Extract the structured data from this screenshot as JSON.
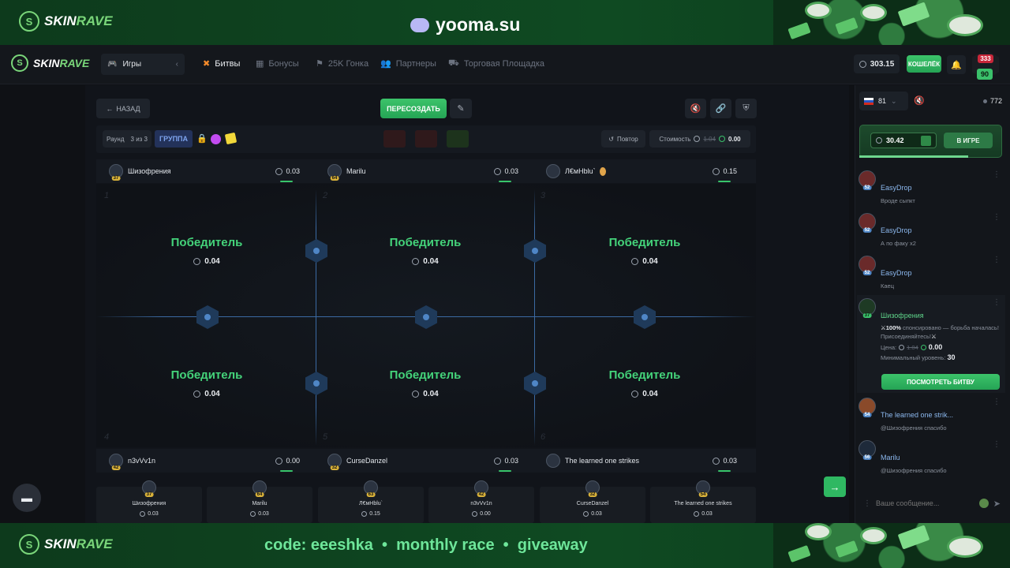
{
  "banner": {
    "brand_skin": "SKIN",
    "brand_rave": "RAVE",
    "site": "yooma.su",
    "promo": "code: eeeshka  •  monthly race  •  giveaway"
  },
  "nav": {
    "games_label": "Игры",
    "items": [
      {
        "label": "Битвы",
        "icon": "crossed-swords-icon",
        "active": true
      },
      {
        "label": "Бонусы",
        "icon": "gift-icon",
        "active": false
      },
      {
        "label": "25K Гонка",
        "icon": "flag-icon",
        "active": false
      },
      {
        "label": "Партнеры",
        "icon": "users-icon",
        "active": false
      },
      {
        "label": "Торговая Площадка",
        "icon": "car-icon",
        "active": false
      }
    ],
    "balance": "303.15",
    "wallet_label": "КОШЕЛЁК",
    "user_level": "90",
    "avatar_badge": "333"
  },
  "battle": {
    "back_label": "НАЗАД",
    "recreate_label": "ПЕРЕСОЗДАТЬ",
    "round_label": "Раунд",
    "round_value": "3 из 3",
    "group_label": "ГРУППА",
    "replay_label": "Повтор",
    "cost_label": "Стоимость",
    "cost_old": "1.04",
    "cost_new": "0.00",
    "top_players": [
      {
        "name": "Шизофрения",
        "level": "37",
        "value": "0.03"
      },
      {
        "name": "Marilu",
        "level": "64",
        "value": "0.03"
      },
      {
        "name": "Л€мНblu`",
        "level": "",
        "value": "0.15"
      }
    ],
    "bottom_players": [
      {
        "name": "n3vVv1n",
        "level": "42",
        "value": "0.00"
      },
      {
        "name": "CurseDanzel",
        "level": "32",
        "value": "0.03"
      },
      {
        "name": "The learned one strikes",
        "level": "",
        "value": "0.03"
      }
    ],
    "cells": [
      {
        "num": "1",
        "winner": "Победитель",
        "amount": "0.04"
      },
      {
        "num": "2",
        "winner": "Победитель",
        "amount": "0.04"
      },
      {
        "num": "3",
        "winner": "Победитель",
        "amount": "0.04"
      },
      {
        "num": "4",
        "winner": "Победитель",
        "amount": "0.04"
      },
      {
        "num": "5",
        "winner": "Победитель",
        "amount": "0.04"
      },
      {
        "num": "6",
        "winner": "Победитель",
        "amount": "0.04"
      }
    ],
    "summary": [
      {
        "name": "Шизофрения",
        "level": "37",
        "value": "0.03"
      },
      {
        "name": "Marilu",
        "level": "64",
        "value": "0.03"
      },
      {
        "name": "Л€мНblu`",
        "level": "63",
        "value": "0.15"
      },
      {
        "name": "n3vVv1n",
        "level": "42",
        "value": "0.00"
      },
      {
        "name": "CurseDanzel",
        "level": "32",
        "value": "0.03"
      },
      {
        "name": "The learned one strikes",
        "level": "54",
        "value": "0.03"
      }
    ]
  },
  "chat": {
    "lang_count": "81",
    "online": "772",
    "rain_amount": "30.42",
    "in_game_label": "В ИГРЕ",
    "messages": [
      {
        "name": "EasyDrop",
        "level": "52",
        "text": "Вроде сыпкт"
      },
      {
        "name": "EasyDrop",
        "level": "52",
        "text": "А по факу x2"
      },
      {
        "name": "EasyDrop",
        "level": "52",
        "text": "Каец"
      }
    ],
    "battle_msg": {
      "name": "Шизофрения",
      "level": "37",
      "percent": "100%",
      "line1": "спонсировано — борьба началась!",
      "line2": "Присоединяйтесь!",
      "price_label": "Цена:",
      "price_old": "1.04",
      "price_new": "0.00",
      "min_level_label": "Минимальный уровень:",
      "min_level": "30",
      "button": "ПОСМОТРЕТЬ БИТВУ"
    },
    "messages2": [
      {
        "name": "The learned one strik...",
        "level": "54",
        "text": "@Шизофрения спасибо"
      },
      {
        "name": "Marilu",
        "level": "56",
        "text": "@Шизофрения спасибо"
      }
    ],
    "input_placeholder": "Ваше сообщение..."
  }
}
